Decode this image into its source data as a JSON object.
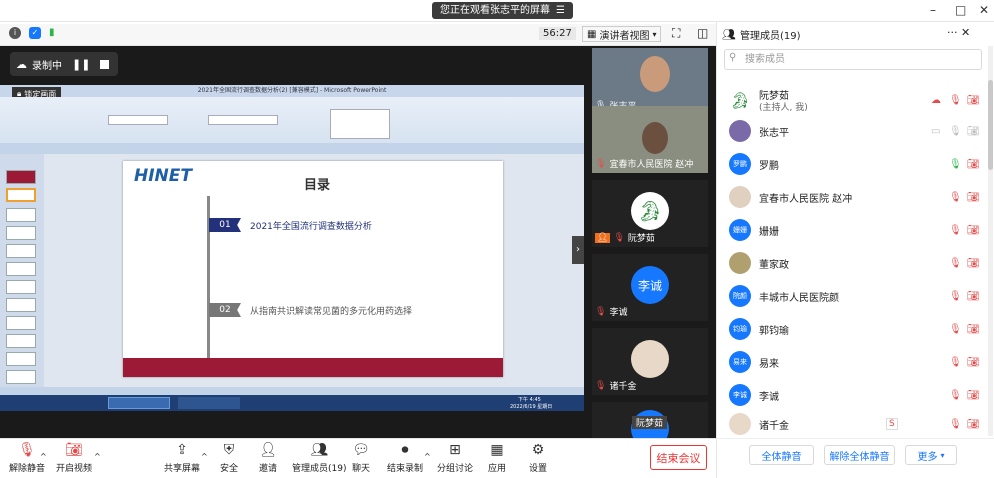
{
  "banner": {
    "text": "您正在观看张志平的屏幕",
    "icon": "list-icon"
  },
  "window": {
    "min": "–",
    "max": "□",
    "close": "✕"
  },
  "topbar": {
    "timer": "56:27",
    "view_label": "演讲者视图"
  },
  "recording": {
    "label": "录制中"
  },
  "lock_screen": {
    "label": "锁定画面"
  },
  "ppt": {
    "window_title": "2021年全国流行调查数据分析(2) [兼容模式] - Microsoft PowerPoint",
    "slide_title": "目录",
    "logo": "HINET",
    "item1_num": "01",
    "item1_text": "2021年全国流行调查数据分析",
    "item2_num": "02",
    "item2_text": "从指南共识解读常见菌的多元化用药选择",
    "taskbar_time": "下午 4:45",
    "taskbar_date": "2022/6/19 星期日"
  },
  "tiles": [
    {
      "name": "张志平"
    },
    {
      "name": "宜春市人民医院 赵冲"
    },
    {
      "name": "阮梦茹"
    },
    {
      "name": "李诚",
      "avatar": "李诚"
    },
    {
      "name": "诸千金"
    },
    {
      "name": "阮梦茹"
    }
  ],
  "bottombar": {
    "mute": "解除静音",
    "video": "开启视频",
    "share": "共享屏幕",
    "security": "安全",
    "invite": "邀请",
    "members": "管理成员(19)",
    "chat": "聊天",
    "record": "结束录制",
    "breakout": "分组讨论",
    "apps": "应用",
    "settings": "设置",
    "end": "结束会议"
  },
  "panel": {
    "title": "管理成员(19)",
    "search_placeholder": "搜索成员",
    "members": [
      {
        "name": "阮梦茹",
        "sub": "(主持人, 我)",
        "avatar": ""
      },
      {
        "name": "张志平",
        "avatar": ""
      },
      {
        "name": "罗鹏",
        "avatar": "罗鹏"
      },
      {
        "name": "宜春市人民医院 赵冲",
        "avatar": ""
      },
      {
        "name": "姗姗",
        "avatar": "姗姗"
      },
      {
        "name": "董家政",
        "avatar": ""
      },
      {
        "name": "丰城市人民医院颜",
        "avatar": "院颜"
      },
      {
        "name": "郭钧瑜",
        "avatar": "钧瑜"
      },
      {
        "name": "易来",
        "avatar": "易来"
      },
      {
        "name": "李诚",
        "avatar": "李诚"
      },
      {
        "name": "诸千金",
        "avatar": ""
      }
    ],
    "mute_all": "全体静音",
    "unmute_all": "解除全体静音",
    "more": "更多"
  },
  "colors": {
    "accent": "#1677ff",
    "danger": "#e54b4b",
    "ppt_red": "#9c1a35"
  }
}
